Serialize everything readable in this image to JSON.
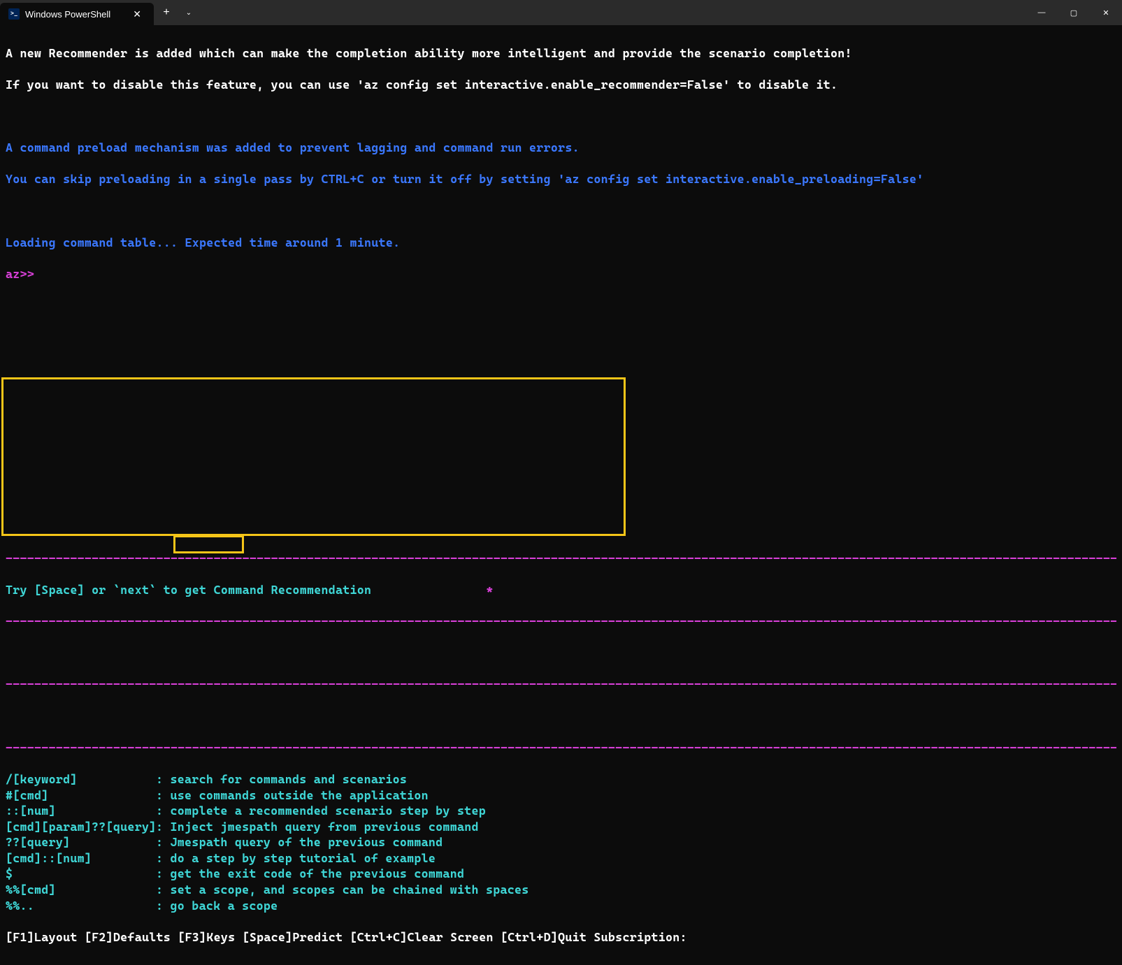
{
  "titlebar": {
    "tab_title": "Windows PowerShell",
    "tab_icon_text": ">_",
    "tab_close": "✕",
    "new_tab": "+",
    "dropdown": "⌄",
    "minimize": "—",
    "maximize": "▢",
    "close": "✕"
  },
  "lines": {
    "l1": "A new Recommender is added which can make the completion ability more intelligent and provide the scenario completion!",
    "l2": "If you want to disable this feature, you can use 'az config set interactive.enable_recommender=False' to disable it.",
    "l3": "A command preload mechanism was added to prevent lagging and command run errors.",
    "l4": "You can skip preloading in a single pass by CTRL+C or turn it off by setting 'az config set interactive.enable_preloading=False'",
    "l5": "Loading command table... Expected time around 1 minute.",
    "prompt": "az>>"
  },
  "dash_line": "-------------------------------------------------------------------------------------------------------------------------------------------------------------",
  "hint": {
    "text": "Try [Space] or `next` to get Command Recommendation",
    "star": "*"
  },
  "help": [
    {
      "key": "/[keyword]",
      "desc": ": search for commands and scenarios"
    },
    {
      "key": "#[cmd]",
      "desc": ": use commands outside the application"
    },
    {
      "key": "::[num]",
      "desc": ": complete a recommended scenario step by step"
    },
    {
      "key": "[cmd][param]??[query]",
      "desc": ": Inject jmespath query from previous command"
    },
    {
      "key": "??[query]",
      "desc": ": Jmespath query of the previous command"
    },
    {
      "key": "[cmd]::[num]",
      "desc": ": do a step by step tutorial of example"
    },
    {
      "key": "$",
      "desc": ": get the exit code of the previous command"
    },
    {
      "key": "%%[cmd]",
      "desc": ": set a scope, and scopes can be chained with spaces"
    },
    {
      "key": "%%..",
      "desc": ": go back a scope"
    }
  ],
  "statusbar": "[F1]Layout [F2]Defaults [F3]Keys [Space]Predict [Ctrl+C]Clear Screen [Ctrl+D]Quit Subscription:"
}
